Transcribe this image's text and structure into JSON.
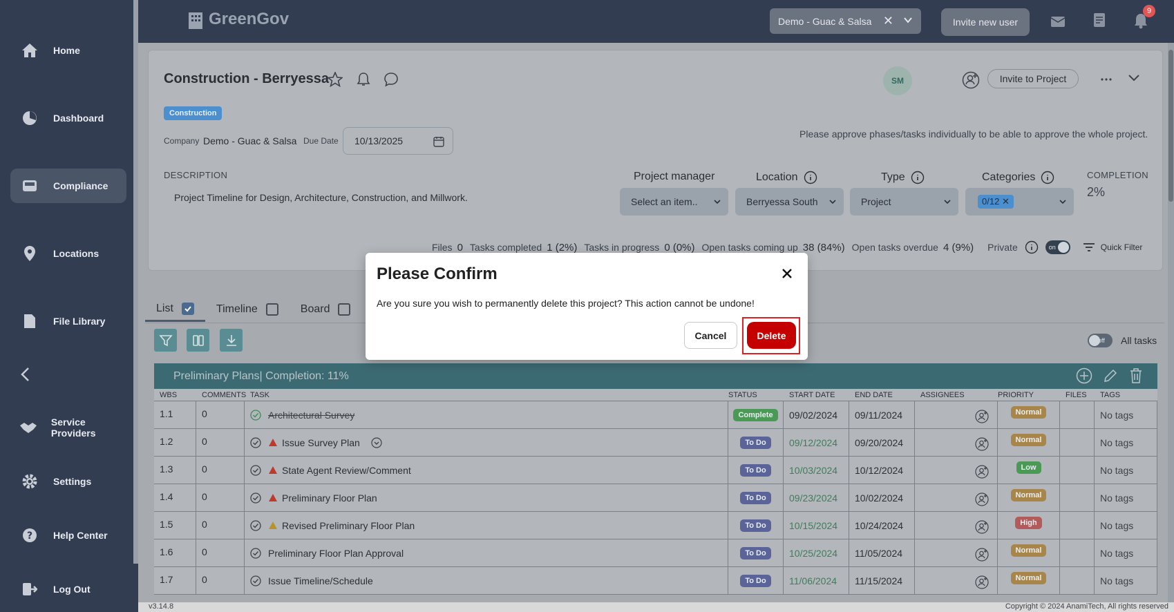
{
  "app": {
    "logo_text": "GreenGov",
    "version": "v3.14.8",
    "copyright": "Copyright © 2024 AnamiTech, All rights reserved"
  },
  "colors": {
    "sidebar": "#323d52",
    "accent_teal": "#3c6a73",
    "delete_red": "#c40000",
    "complete_green": "#4a9a55",
    "todo_purple": "#5b6499"
  },
  "sidebar": {
    "items": [
      {
        "label": "Home",
        "icon": "home-icon"
      },
      {
        "label": "Dashboard",
        "icon": "pie-chart-icon"
      },
      {
        "label": "Compliance",
        "icon": "inbox-icon",
        "active": true
      },
      {
        "label": "Locations",
        "icon": "location-pin-icon"
      },
      {
        "label": "File Library",
        "icon": "file-icon"
      },
      {
        "label": "Service Providers",
        "icon": "handshake-icon"
      },
      {
        "label": "Settings",
        "icon": "gear-icon"
      },
      {
        "label": "Help Center",
        "icon": "help-icon"
      },
      {
        "label": "Log Out",
        "icon": "logout-icon"
      }
    ]
  },
  "topbar": {
    "company_select": "Demo - Guac & Salsa",
    "invite_user": "Invite new user",
    "notification_count": "9"
  },
  "project": {
    "title": "Construction - Berryessa",
    "category_badge": "Construction",
    "company_label": "Company",
    "company_value": "Demo - Guac & Salsa",
    "due_label": "Due Date",
    "due_value": "10/13/2025",
    "approve_note": "Please approve phases/tasks individually to be able to approve the whole project.",
    "description_label": "DESCRIPTION",
    "description": "Project Timeline for Design, Architecture, Construction, and Millwork.",
    "avatar_initials": "SM",
    "invite_project": "Invite to Project",
    "fields": {
      "manager_label": "Project manager",
      "manager_value": "Select an item..",
      "location_label": "Location",
      "location_value": "Berryessa South",
      "type_label": "Type",
      "type_value": "Project",
      "categories_label": "Categories",
      "categories_value": "0/12"
    },
    "completion_label": "COMPLETION",
    "completion_value": "2%",
    "stats": {
      "files_label": "Files",
      "files": "0",
      "completed_label": "Tasks completed",
      "completed": "1 (2%)",
      "inprogress_label": "Tasks in progress",
      "inprogress": "0 (0%)",
      "upcoming_label": "Open tasks coming up",
      "upcoming": "38 (84%)",
      "overdue_label": "Open tasks overdue",
      "overdue": "4 (9%)",
      "private_label": "Private",
      "private_toggle": "on",
      "quick_filter": "Quick Filter"
    }
  },
  "view_tabs": [
    {
      "label": "List",
      "checked": true
    },
    {
      "label": "Timeline",
      "checked": false
    },
    {
      "label": "Board",
      "checked": false
    }
  ],
  "all_tasks": {
    "toggle": "off",
    "label": "All tasks"
  },
  "phase": {
    "title": "Preliminary Plans",
    "completion": " | Completion: 11%"
  },
  "table": {
    "headers": [
      "WBS",
      "COMMENTS",
      "TASK",
      "STATUS",
      "START DATE",
      "END DATE",
      "ASSIGNEES",
      "PRIORITY",
      "FILES",
      "TAGS"
    ],
    "rows": [
      {
        "wbs": "1.1",
        "comments": "0",
        "task": "Architectural Survey",
        "status": "Complete",
        "start": "09/02/2024",
        "end": "09/11/2024",
        "priority": "Normal",
        "tags": "No tags"
      },
      {
        "wbs": "1.2",
        "comments": "0",
        "task": "Issue Survey Plan",
        "status": "To Do",
        "start": "09/12/2024",
        "end": "09/20/2024",
        "priority": "Normal",
        "tags": "No tags"
      },
      {
        "wbs": "1.3",
        "comments": "0",
        "task": "State Agent Review/Comment",
        "status": "To Do",
        "start": "10/03/2024",
        "end": "10/12/2024",
        "priority": "Low",
        "tags": "No tags"
      },
      {
        "wbs": "1.4",
        "comments": "0",
        "task": "Preliminary Floor Plan",
        "status": "To Do",
        "start": "09/23/2024",
        "end": "10/02/2024",
        "priority": "Normal",
        "tags": "No tags"
      },
      {
        "wbs": "1.5",
        "comments": "0",
        "task": "Revised Preliminary Floor Plan",
        "status": "To Do",
        "start": "10/15/2024",
        "end": "10/24/2024",
        "priority": "High",
        "tags": "No tags"
      },
      {
        "wbs": "1.6",
        "comments": "0",
        "task": "Preliminary Floor Plan Approval",
        "status": "To Do",
        "start": "10/25/2024",
        "end": "11/05/2024",
        "priority": "Normal",
        "tags": "No tags"
      },
      {
        "wbs": "1.7",
        "comments": "0",
        "task": "Issue Timeline/Schedule",
        "status": "To Do",
        "start": "11/06/2024",
        "end": "11/15/2024",
        "priority": "Normal",
        "tags": "No tags"
      }
    ]
  },
  "modal": {
    "title": "Please Confirm",
    "body": "Are you sure you wish to permanently delete this project? This action cannot be undone!",
    "cancel": "Cancel",
    "delete": "Delete"
  }
}
